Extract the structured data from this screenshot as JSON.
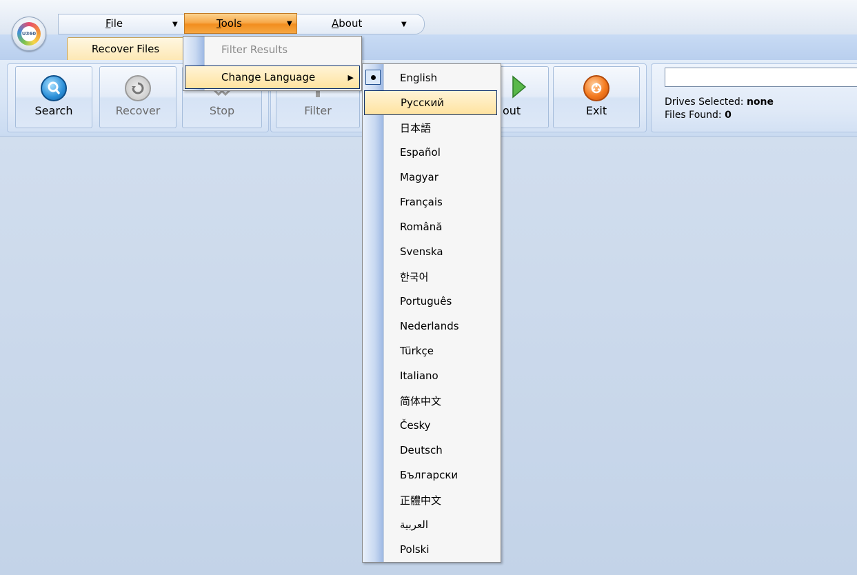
{
  "app": {
    "logo_text": "U360"
  },
  "menubar": {
    "file": {
      "prefix": "",
      "mnemonic": "F",
      "rest": "ile"
    },
    "tools": {
      "prefix": "",
      "mnemonic": "T",
      "rest": "ools"
    },
    "about": {
      "prefix": "",
      "mnemonic": "A",
      "rest": "bout"
    }
  },
  "ribbon": {
    "tab_label": "Recover Files",
    "buttons": {
      "search": "Search",
      "recover": "Recover",
      "stop": "Stop",
      "filter": "Filter",
      "about": "out",
      "exit": "Exit"
    },
    "status": {
      "drives_label": "Drives Selected: ",
      "drives_value": "none",
      "files_label": "Files Found: ",
      "files_value": "0"
    },
    "search_value": ""
  },
  "tools_menu": {
    "items": [
      {
        "label": "Filter Results",
        "enabled": false
      },
      {
        "label": "Change Language",
        "has_submenu": true,
        "highlighted": true
      }
    ]
  },
  "language_menu": {
    "selected": "English",
    "hovered": "Русский",
    "items": [
      "English",
      "Русский",
      "日本語",
      "Español",
      "Magyar",
      "Français",
      "Română",
      "Svenska",
      "한국어",
      "Português",
      "Nederlands",
      "Türkçe",
      "Italiano",
      "简体中文",
      "Česky",
      "Deutsch",
      "Български",
      "正體中文",
      "العربية",
      "Polski"
    ]
  },
  "colors": {
    "menu_highlight": "#ffe3a0",
    "tools_active": "#f28e1f",
    "ribbon_bg": "#dfe9f7"
  }
}
